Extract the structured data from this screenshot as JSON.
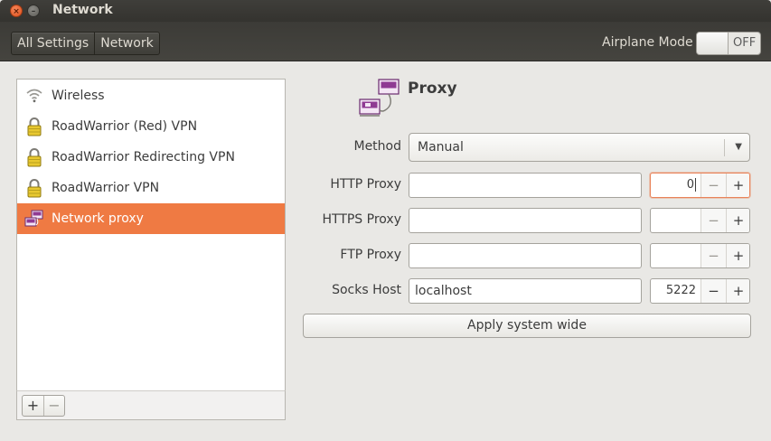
{
  "window": {
    "title": "Network",
    "close_glyph": "×",
    "minimize_glyph": "–"
  },
  "toolbar": {
    "breadcrumbs": [
      "All Settings",
      "Network"
    ],
    "airplane_mode_label": "Airplane Mode",
    "airplane_mode_state": "OFF"
  },
  "sidebar": {
    "items": [
      {
        "label": "Wireless",
        "icon": "wifi-icon"
      },
      {
        "label": "RoadWarrior (Red) VPN",
        "icon": "lock-icon"
      },
      {
        "label": "RoadWarrior Redirecting VPN",
        "icon": "lock-icon"
      },
      {
        "label": "RoadWarrior VPN",
        "icon": "lock-icon"
      },
      {
        "label": "Network proxy",
        "icon": "network-proxy-icon",
        "selected": true
      }
    ],
    "add_glyph": "+",
    "remove_glyph": "−"
  },
  "proxy": {
    "title": "Proxy",
    "method_label": "Method",
    "method_value": "Manual",
    "rows": [
      {
        "label": "HTTP Proxy",
        "host": "",
        "port": "0"
      },
      {
        "label": "HTTPS Proxy",
        "host": "",
        "port": ""
      },
      {
        "label": "FTP Proxy",
        "host": "",
        "port": ""
      },
      {
        "label": "Socks Host",
        "host": "localhost",
        "port": "5222"
      }
    ],
    "minus_glyph": "−",
    "plus_glyph": "+",
    "apply_label": "Apply system wide"
  },
  "colors": {
    "selection": "#ef7a43",
    "titlebar": "#3c3b37",
    "close_button": "#e0501c",
    "focus_ring": "#e9835a"
  }
}
